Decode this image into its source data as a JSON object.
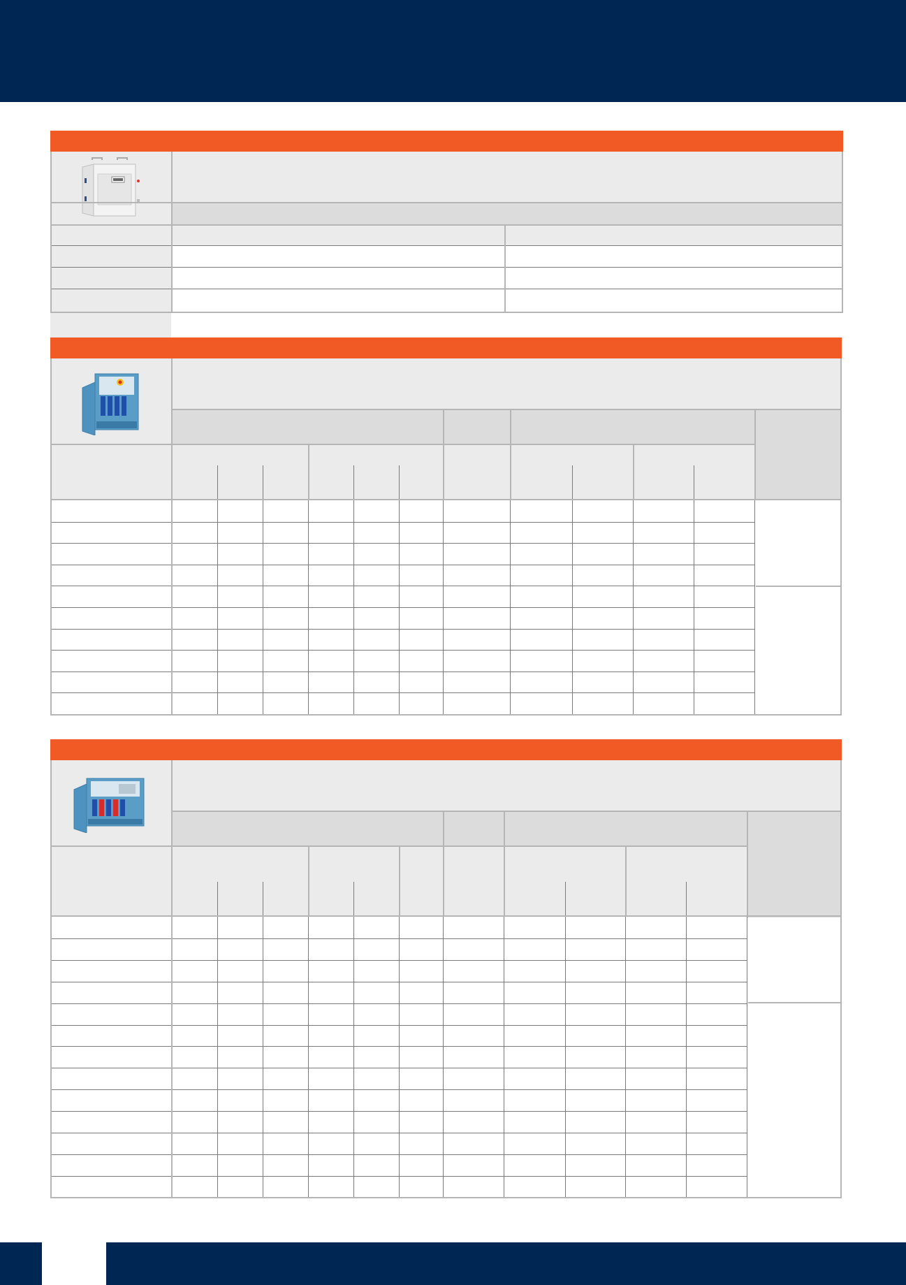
{
  "colors": {
    "navy": "#002753",
    "orange": "#f15a24",
    "header_gray": "#ebebeb",
    "band_gray": "#dcdcdc"
  },
  "sections": [
    {
      "product_icon": "distribution-box-icon",
      "rows": 4
    },
    {
      "product_icon": "socket-distribution-board-icon",
      "rows": 10
    },
    {
      "product_icon": "socket-distribution-board-icon",
      "rows": 13
    }
  ]
}
